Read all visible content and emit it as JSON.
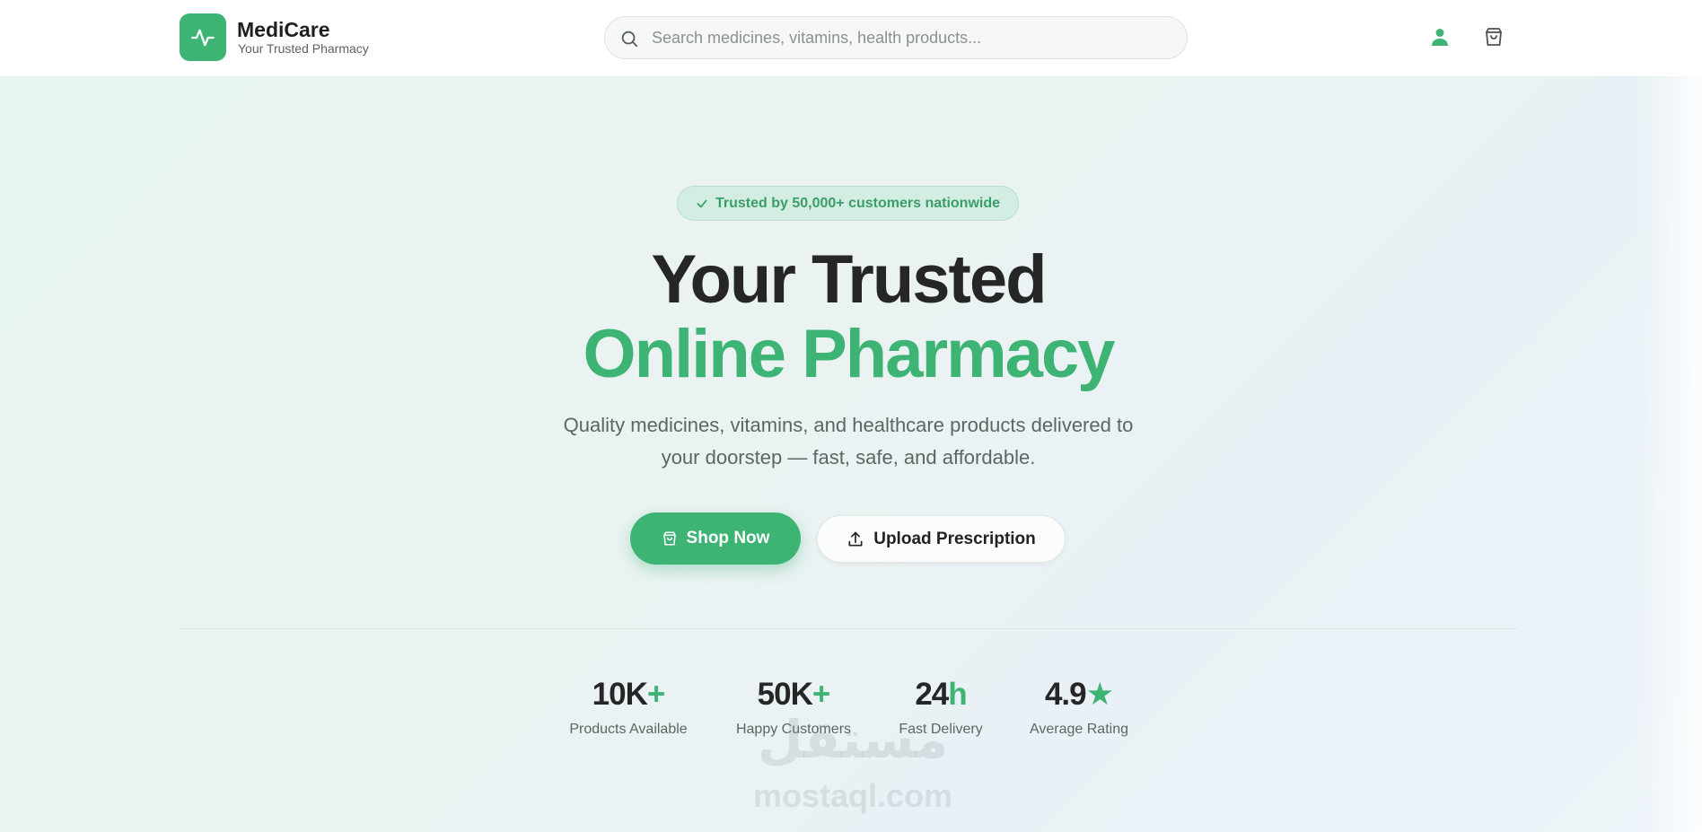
{
  "header": {
    "brand_name": "MediCare",
    "brand_tagline": "Your Trusted Pharmacy",
    "search_placeholder": "Search medicines, vitamins, health products...",
    "icons": {
      "logo": "pulse-icon",
      "search": "search-icon",
      "user": "user-icon",
      "cart": "shopping-bag-icon"
    }
  },
  "hero": {
    "badge": "Trusted by 50,000+ customers nationwide",
    "title_line1": "Your Trusted",
    "title_line2": "Online Pharmacy",
    "subtitle_line1": "Quality medicines, vitamins, and healthcare products delivered to",
    "subtitle_line2": "your doorstep — fast, safe, and affordable.",
    "primary_button": "Shop Now",
    "secondary_button": "Upload Prescription"
  },
  "stats": [
    {
      "value": "10K",
      "suffix": "+",
      "label": "Products Available"
    },
    {
      "value": "50K",
      "suffix": "+",
      "label": "Happy Customers"
    },
    {
      "value": "24",
      "suffix": "h",
      "label": "Fast Delivery"
    },
    {
      "value": "4.9",
      "suffix": "★",
      "label": "Average Rating"
    }
  ],
  "watermark": {
    "arabic": "مستقل",
    "latin": "mostaql.com"
  },
  "colors": {
    "accent": "#3db374",
    "text_dark": "#262626",
    "text_muted": "#5e6563",
    "badge_bg": "#d4ede2"
  }
}
